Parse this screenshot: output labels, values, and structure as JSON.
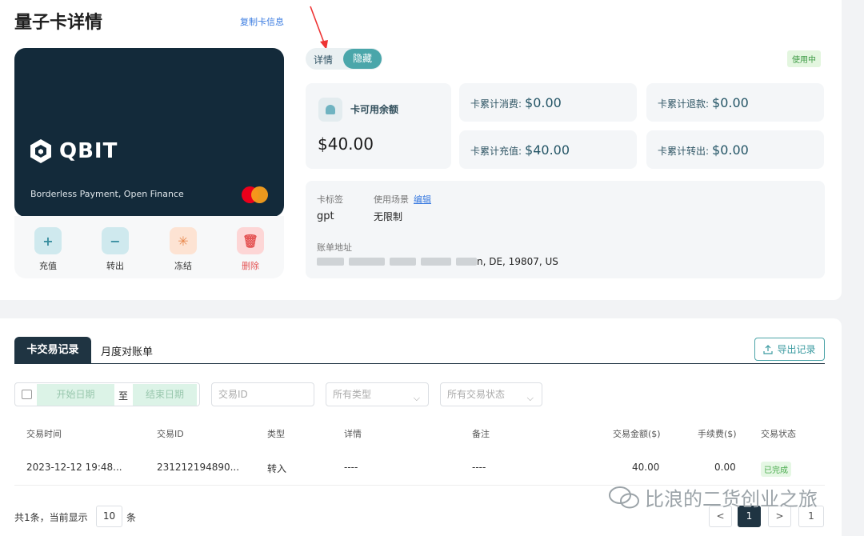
{
  "page": {
    "title": "量子卡详情",
    "copy_info": "复制卡信息"
  },
  "card": {
    "brand": "QBIT",
    "tagline": "Borderless Payment, Open Finance"
  },
  "actions": [
    {
      "label": "充值",
      "icon": "recharge-icon"
    },
    {
      "label": "转出",
      "icon": "transfer-out-icon"
    },
    {
      "label": "冻结",
      "icon": "freeze-icon"
    },
    {
      "label": "删除",
      "icon": "delete-icon"
    }
  ],
  "toggle": {
    "details": "详情",
    "hide": "隐藏"
  },
  "status": "使用中",
  "balance": {
    "label": "卡可用余额",
    "value": "$40.00"
  },
  "stats": {
    "spent": {
      "label": "卡累计消费:",
      "value": "$0.00"
    },
    "refund": {
      "label": "卡累计退款:",
      "value": "$0.00"
    },
    "recharge": {
      "label": "卡累计充值:",
      "value": "$40.00"
    },
    "transfer_out": {
      "label": "卡累计转出:",
      "value": "$0.00"
    }
  },
  "info": {
    "tag_label": "卡标签",
    "tag_value": "gpt",
    "scene_label": "使用场景",
    "edit": "编辑",
    "scene_value": "无限制",
    "address_label": "账单地址",
    "address_tail": "n, DE, 19807, US"
  },
  "tabs": {
    "transactions": "卡交易记录",
    "monthly": "月度对账单",
    "export": "导出记录"
  },
  "filters": {
    "start_date": "开始日期",
    "to": "至",
    "end_date": "结束日期",
    "tx_id_placeholder": "交易ID",
    "type": "所有类型",
    "status": "所有交易状态"
  },
  "table": {
    "headers": [
      "交易时间",
      "交易ID",
      "类型",
      "详情",
      "备注",
      "交易金额($)",
      "手续费($)",
      "交易状态"
    ],
    "rows": [
      {
        "time": "2023-12-12 19:48...",
        "id": "231212194890...",
        "type": "转入",
        "detail": "----",
        "note": "----",
        "amount": "40.00",
        "fee": "0.00",
        "status": "已完成"
      }
    ]
  },
  "pagination": {
    "total": "共1条，当前显示",
    "size": "10",
    "unit": "条",
    "prev": "<",
    "current": "1",
    "next": ">",
    "last": "1"
  },
  "watermark": "比浪的二货创业之旅",
  "colors": {
    "card_bg": "#132a3a",
    "accent": "#4aa6aa",
    "status_green": "#3d9a44",
    "link": "#3a7be0"
  }
}
